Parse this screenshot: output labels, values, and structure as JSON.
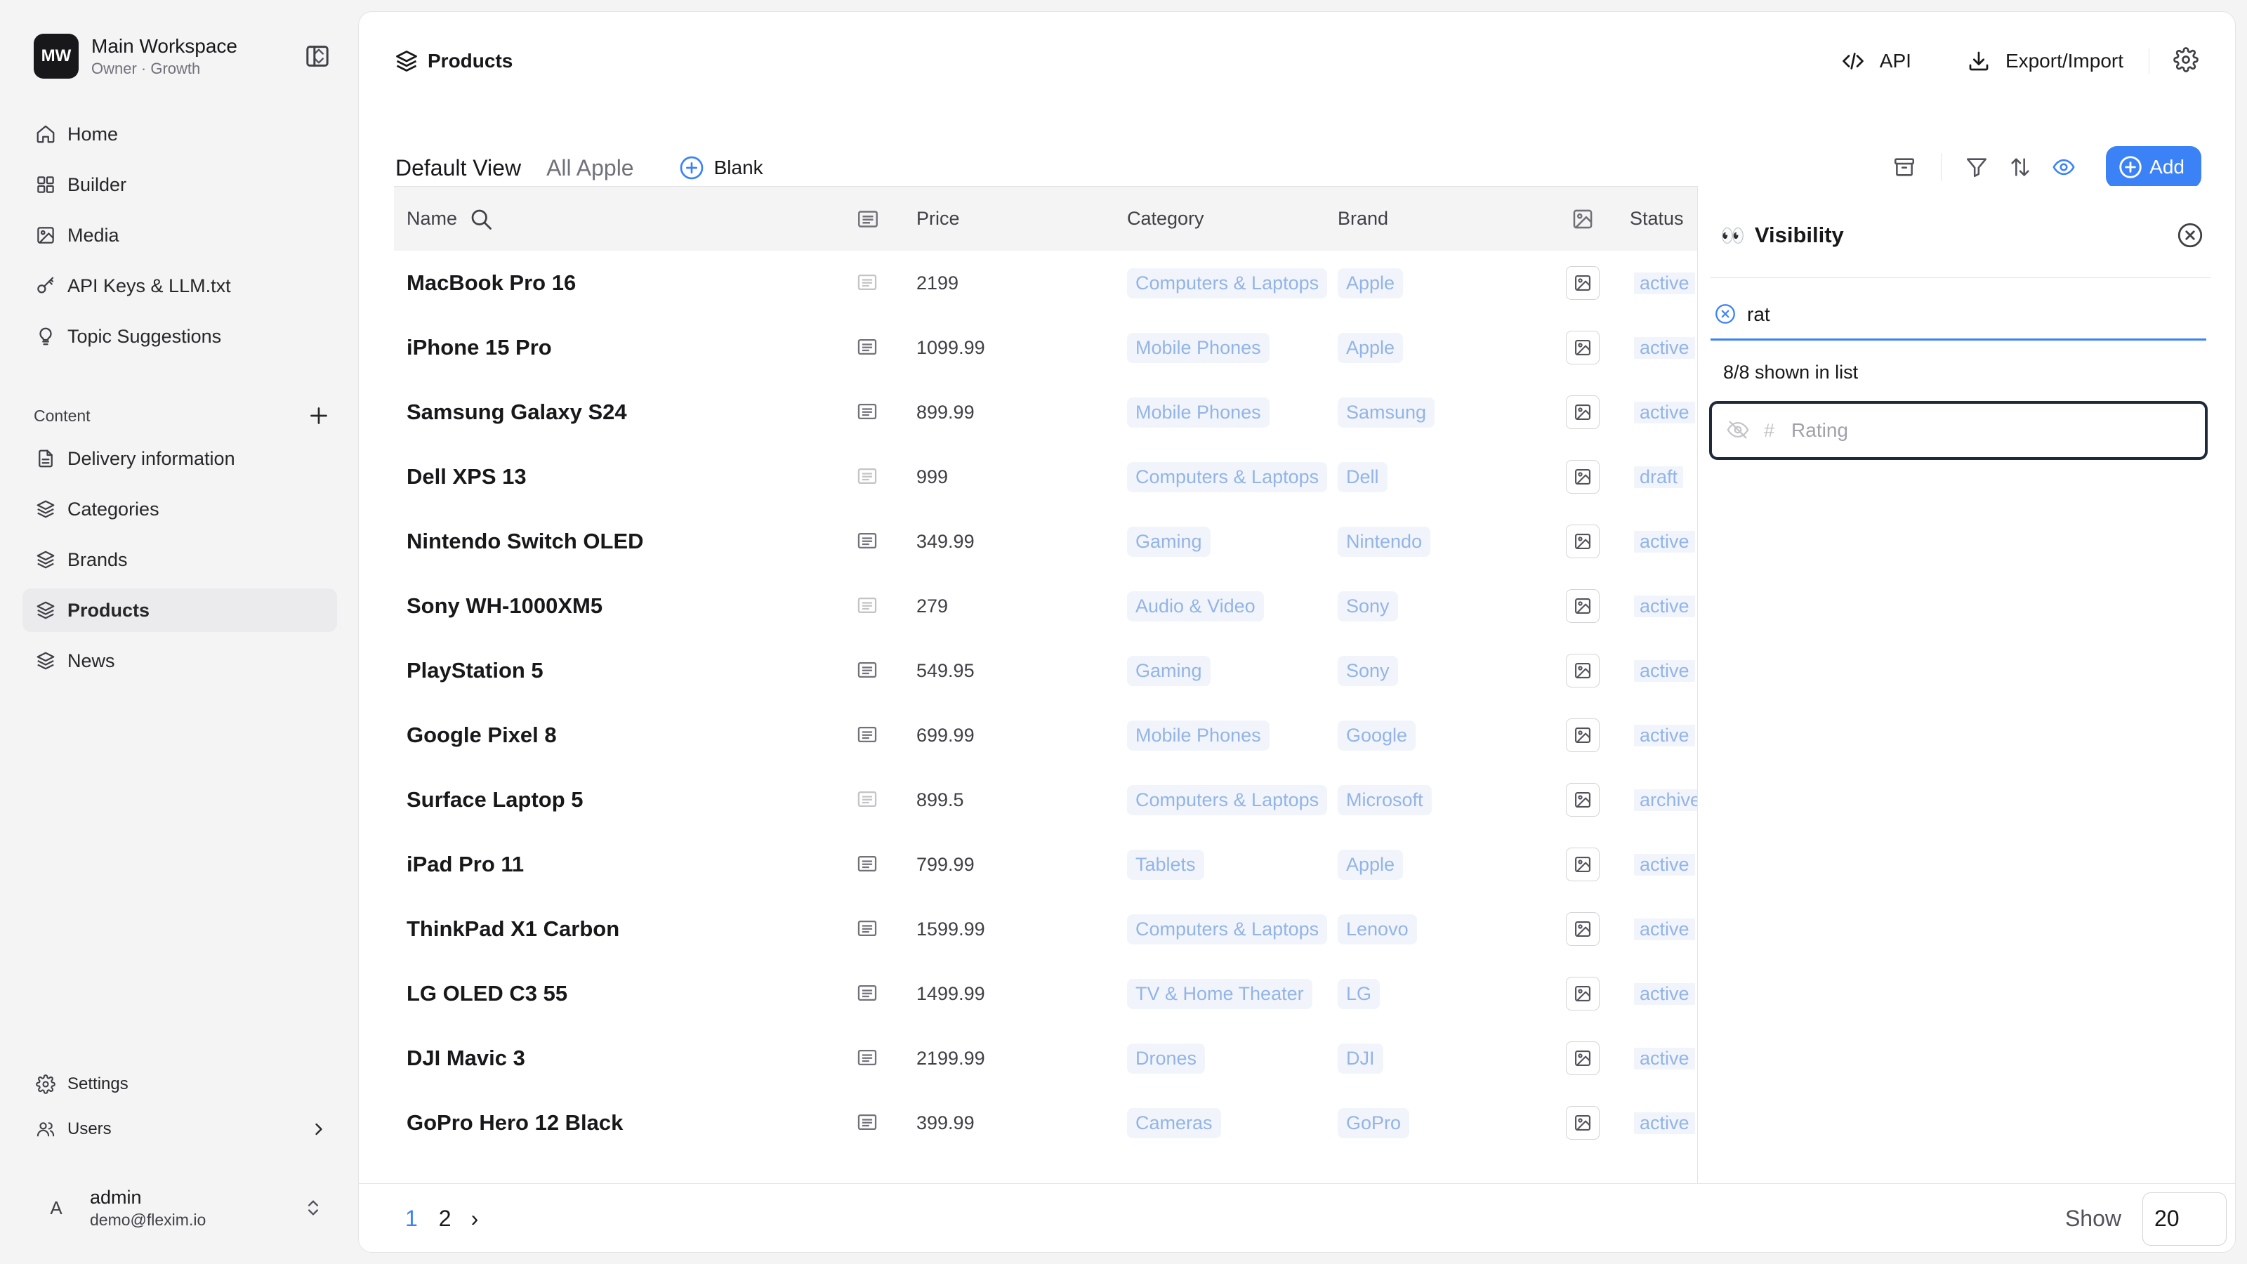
{
  "workspace": {
    "initials": "MW",
    "name": "Main Workspace",
    "subtitle": "Owner · Growth"
  },
  "nav": [
    {
      "label": "Home",
      "icon": "home-icon"
    },
    {
      "label": "Builder",
      "icon": "layout-grid-icon"
    },
    {
      "label": "Media",
      "icon": "image-icon"
    },
    {
      "label": "API Keys & LLM.txt",
      "icon": "key-icon"
    },
    {
      "label": "Topic Suggestions",
      "icon": "lightbulb-icon"
    }
  ],
  "content_section": {
    "title": "Content",
    "items": [
      {
        "label": "Delivery information",
        "icon": "document-icon",
        "active": false
      },
      {
        "label": "Categories",
        "icon": "layers-icon",
        "active": false
      },
      {
        "label": "Brands",
        "icon": "layers-icon",
        "active": false
      },
      {
        "label": "Products",
        "icon": "layers-icon",
        "active": true
      },
      {
        "label": "News",
        "icon": "layers-icon",
        "active": false
      }
    ]
  },
  "bottom_nav": {
    "settings": "Settings",
    "users": "Users"
  },
  "user": {
    "initial": "A",
    "name": "admin",
    "email": "demo@flexim.io"
  },
  "header": {
    "title": "Products",
    "api_label": "API",
    "export_label": "Export/Import"
  },
  "views": {
    "tabs": [
      "Default View",
      "All Apple"
    ],
    "active": "Default View",
    "blank_label": "Blank"
  },
  "toolbar": {
    "add_label": "Add"
  },
  "table": {
    "columns": {
      "name": "Name",
      "price": "Price",
      "category": "Category",
      "brand": "Brand",
      "status": "Status"
    },
    "rows": [
      {
        "name": "MacBook Pro 16",
        "desc_faded": true,
        "price": "2199",
        "category": "Computers & Laptops",
        "brand": "Apple",
        "status": "active"
      },
      {
        "name": "iPhone 15 Pro",
        "desc_faded": false,
        "price": "1099.99",
        "category": "Mobile Phones",
        "brand": "Apple",
        "status": "active"
      },
      {
        "name": "Samsung Galaxy S24",
        "desc_faded": false,
        "price": "899.99",
        "category": "Mobile Phones",
        "brand": "Samsung",
        "status": "active"
      },
      {
        "name": "Dell XPS 13",
        "desc_faded": true,
        "price": "999",
        "category": "Computers & Laptops",
        "brand": "Dell",
        "status": "draft"
      },
      {
        "name": "Nintendo Switch OLED",
        "desc_faded": false,
        "price": "349.99",
        "category": "Gaming",
        "brand": "Nintendo",
        "status": "active"
      },
      {
        "name": "Sony WH-1000XM5",
        "desc_faded": true,
        "price": "279",
        "category": "Audio & Video",
        "brand": "Sony",
        "status": "active"
      },
      {
        "name": "PlayStation 5",
        "desc_faded": false,
        "price": "549.95",
        "category": "Gaming",
        "brand": "Sony",
        "status": "active"
      },
      {
        "name": "Google Pixel 8",
        "desc_faded": false,
        "price": "699.99",
        "category": "Mobile Phones",
        "brand": "Google",
        "status": "active"
      },
      {
        "name": "Surface Laptop 5",
        "desc_faded": true,
        "price": "899.5",
        "category": "Computers & Laptops",
        "brand": "Microsoft",
        "status": "archived"
      },
      {
        "name": "iPad Pro 11",
        "desc_faded": false,
        "price": "799.99",
        "category": "Tablets",
        "brand": "Apple",
        "status": "active"
      },
      {
        "name": "ThinkPad X1 Carbon",
        "desc_faded": false,
        "price": "1599.99",
        "category": "Computers & Laptops",
        "brand": "Lenovo",
        "status": "active"
      },
      {
        "name": "LG OLED C3 55",
        "desc_faded": false,
        "price": "1499.99",
        "category": "TV & Home Theater",
        "brand": "LG",
        "status": "active"
      },
      {
        "name": "DJI Mavic 3",
        "desc_faded": false,
        "price": "2199.99",
        "category": "Drones",
        "brand": "DJI",
        "status": "active"
      },
      {
        "name": "GoPro Hero 12 Black",
        "desc_faded": false,
        "price": "399.99",
        "category": "Cameras",
        "brand": "GoPro",
        "status": "active"
      }
    ]
  },
  "visibility": {
    "emoji": "👀",
    "title": "Visibility",
    "search_value": "rat",
    "count_text": "8/8 shown in list",
    "field": {
      "type_symbol": "#",
      "label": "Rating"
    }
  },
  "pagination": {
    "pages": [
      "1",
      "2"
    ],
    "current": "1",
    "next": "›",
    "show_label": "Show",
    "page_size": "20"
  },
  "colors": {
    "accent": "#3b82f6",
    "tag_text": "#93b4e6",
    "tag_bg": "#f1f5fb",
    "active_nav_bg": "#ebebed"
  }
}
